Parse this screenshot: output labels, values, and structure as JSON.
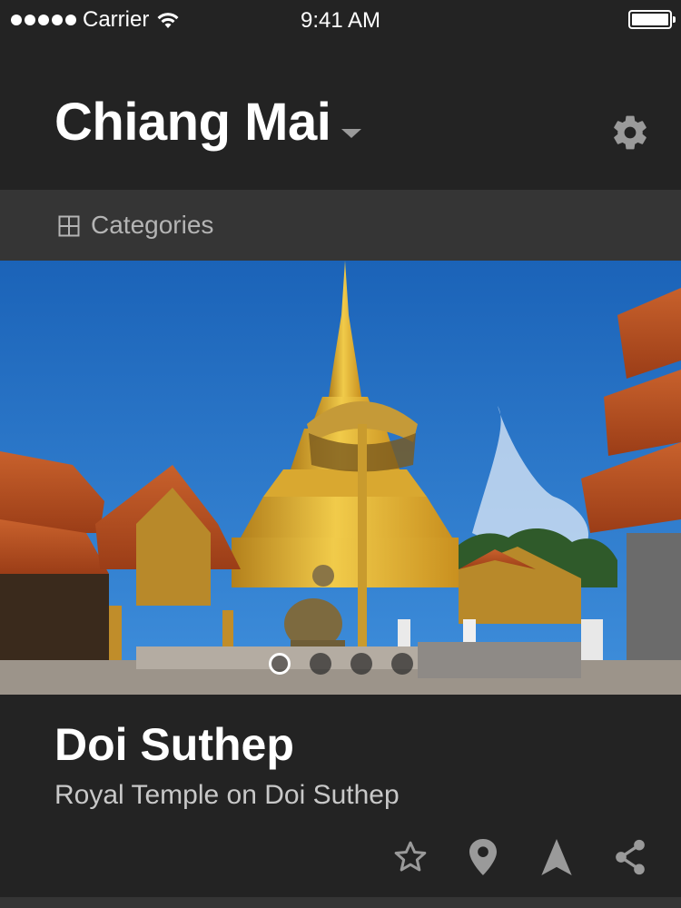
{
  "status_bar": {
    "carrier": "Carrier",
    "time": "9:41 AM"
  },
  "header": {
    "city": "Chiang Mai",
    "dropdown_icon": "caret-down-icon",
    "settings_icon": "gear-icon"
  },
  "categories": {
    "icon": "grid-icon",
    "label": "Categories"
  },
  "hero": {
    "image": "temple-photo",
    "pager": {
      "count": 4,
      "active_index": 0
    }
  },
  "place": {
    "title": "Doi Suthep",
    "subtitle": "Royal Temple on Doi Suthep"
  },
  "actions": [
    "star-icon",
    "map-pin-icon",
    "navigate-icon",
    "share-icon"
  ],
  "colors": {
    "background": "#232323",
    "categories_bar": "#353535",
    "muted_text": "#b4b4b4",
    "icon_gray": "#9a9a9a"
  }
}
